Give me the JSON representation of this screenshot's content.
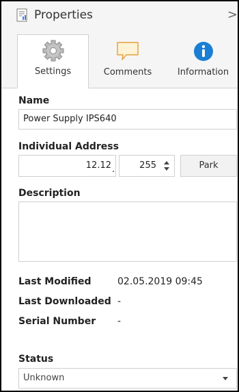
{
  "panel": {
    "title": "Properties",
    "collapse_glyph": ">"
  },
  "tabs": [
    {
      "label": "Settings",
      "icon": "gear-icon",
      "active": true
    },
    {
      "label": "Comments",
      "icon": "speech-bubble-icon",
      "active": false
    },
    {
      "label": "Information",
      "icon": "info-icon",
      "active": false
    }
  ],
  "form": {
    "name_label": "Name",
    "name_value": "Power Supply IPS640",
    "address_label": "Individual Address",
    "address_main": "12.12",
    "address_separator": ".",
    "address_device": "255",
    "park_label": "Park",
    "description_label": "Description",
    "description_value": ""
  },
  "meta": {
    "last_modified_label": "Last Modified",
    "last_modified_value": "02.05.2019 09:45",
    "last_downloaded_label": "Last Downloaded",
    "last_downloaded_value": "-",
    "serial_number_label": "Serial Number",
    "serial_number_value": "-"
  },
  "status": {
    "label": "Status",
    "selected": "Unknown"
  },
  "colors": {
    "info_blue": "#1a7fd4",
    "comment_orange": "#e8a23a",
    "gear_gray": "#9a9a9a"
  }
}
